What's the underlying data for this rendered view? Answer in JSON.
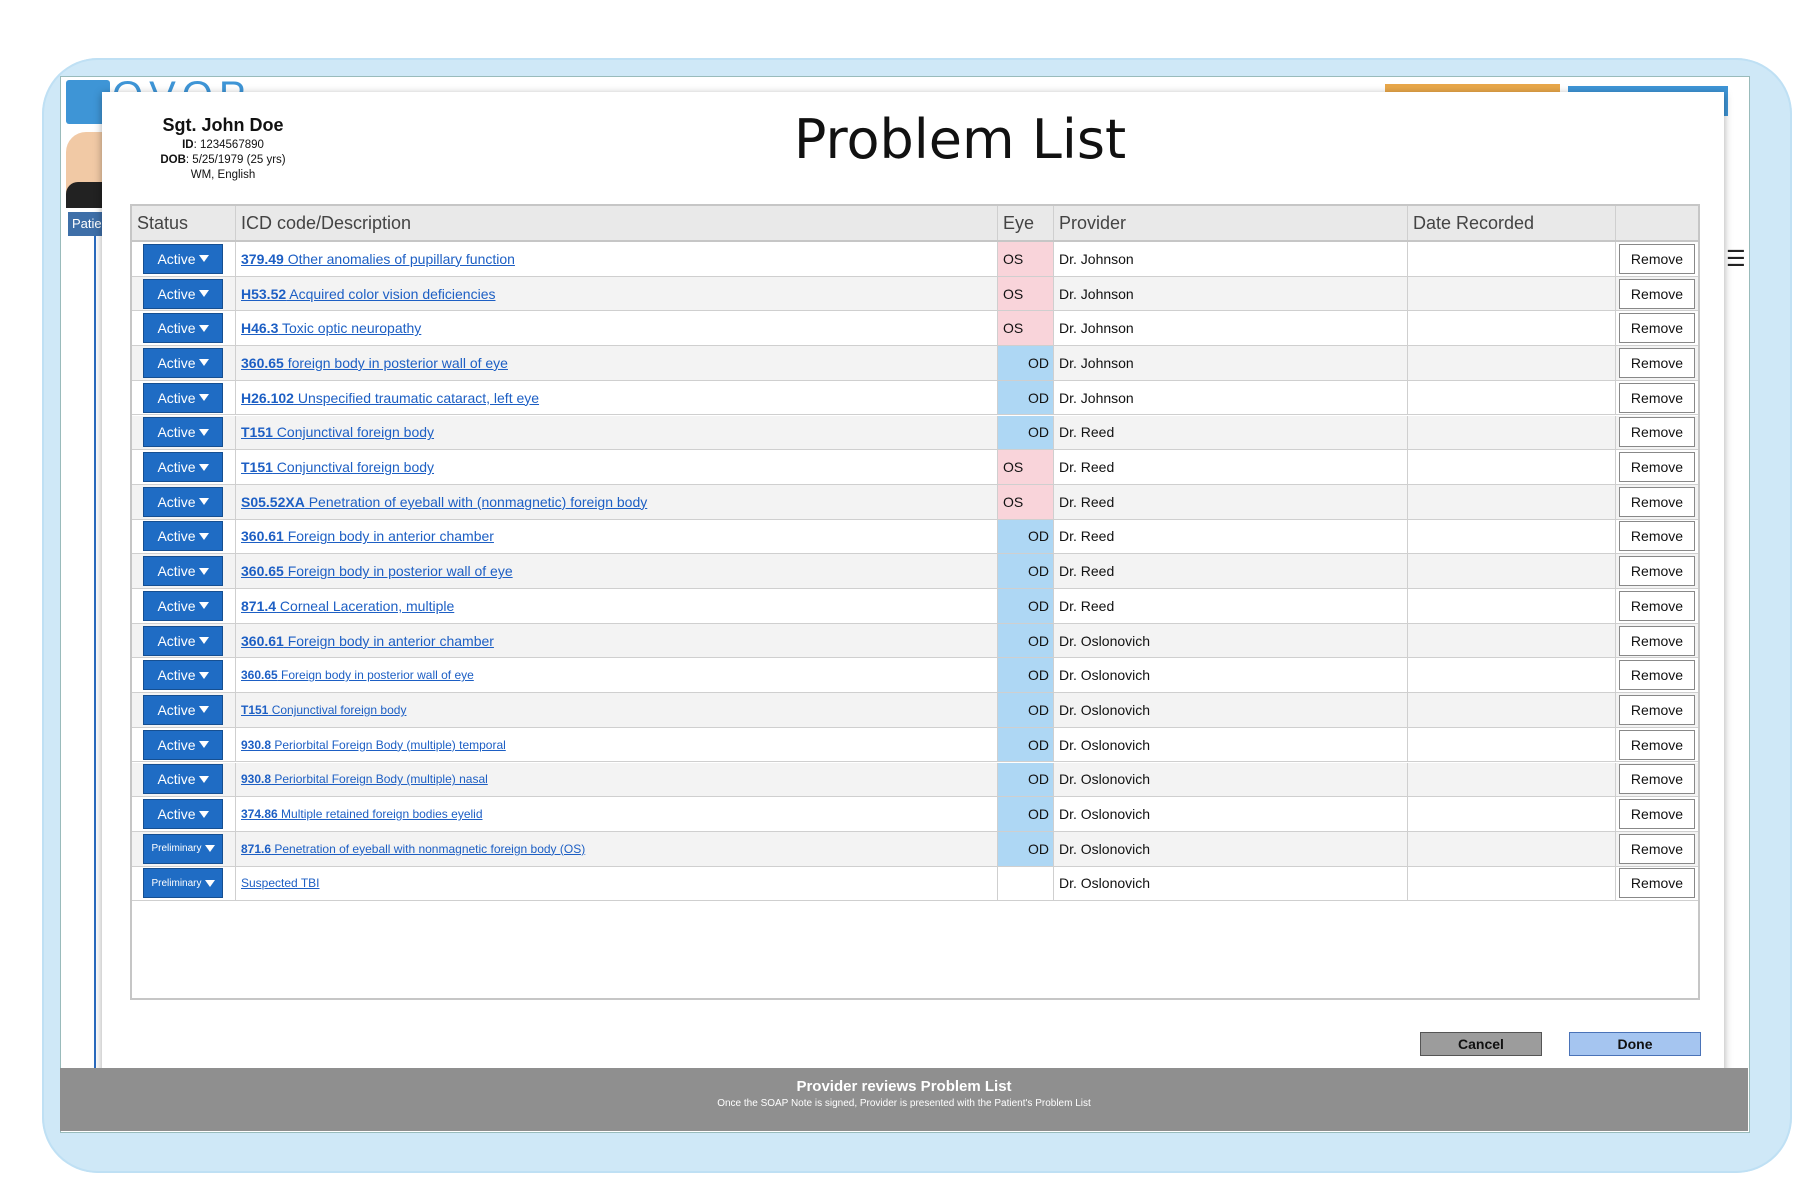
{
  "app": {
    "logo_text": "OVOP",
    "patient_tab": "Patie"
  },
  "patient": {
    "name": "Sgt. John Doe",
    "id_label": "ID",
    "id_value": ": 1234567890",
    "dob_label": "DOB",
    "dob_value": ": 5/25/1979 (25 yrs)",
    "demo": "WM, English"
  },
  "title": "Problem List",
  "columns": {
    "status": "Status",
    "desc": "ICD code/Description",
    "eye": "Eye",
    "provider": "Provider",
    "date": "Date Recorded",
    "action": ""
  },
  "rows": [
    {
      "status": "Active",
      "code": "379.49",
      "desc": " Other anomalies of pupillary function",
      "eye": "OS",
      "provider": "Dr. Johnson",
      "date": "",
      "action": "Remove"
    },
    {
      "status": "Active",
      "code": "H53.52",
      "desc": " Acquired color vision deficiencies",
      "eye": "OS",
      "provider": "Dr. Johnson",
      "date": "",
      "action": "Remove"
    },
    {
      "status": "Active",
      "code": "H46.3",
      "desc": " Toxic optic neuropathy",
      "eye": "OS",
      "provider": "Dr. Johnson",
      "date": "",
      "action": "Remove"
    },
    {
      "status": "Active",
      "code": "360.65",
      "desc": " foreign body in posterior wall of eye",
      "eye": "OD",
      "provider": "Dr. Johnson",
      "date": "",
      "action": "Remove"
    },
    {
      "status": "Active",
      "code": "H26.102",
      "desc": " Unspecified traumatic cataract, left eye",
      "eye": "OD",
      "provider": "Dr. Johnson",
      "date": "",
      "action": "Remove"
    },
    {
      "status": "Active",
      "code": "T151",
      "desc": " Conjunctival foreign body",
      "eye": "OD",
      "provider": "Dr. Reed",
      "date": "",
      "action": "Remove"
    },
    {
      "status": "Active",
      "code": "T151",
      "desc": " Conjunctival foreign body",
      "eye": "OS",
      "provider": "Dr. Reed",
      "date": "",
      "action": "Remove"
    },
    {
      "status": "Active",
      "code": "S05.52XA",
      "desc": " Penetration of eyeball with (nonmagnetic) foreign body",
      "eye": "OS",
      "provider": "Dr. Reed",
      "date": "",
      "action": "Remove"
    },
    {
      "status": "Active",
      "code": "360.61",
      "desc": " Foreign body in anterior chamber",
      "eye": "OD",
      "provider": "Dr. Reed",
      "date": "",
      "action": "Remove"
    },
    {
      "status": "Active",
      "code": "360.65",
      "desc": " Foreign body in posterior wall of eye",
      "eye": "OD",
      "provider": "Dr. Reed",
      "date": "",
      "action": "Remove"
    },
    {
      "status": "Active",
      "code": "871.4",
      "desc": " Corneal Laceration, multiple",
      "eye": "OD",
      "provider": "Dr. Reed",
      "date": "",
      "action": "Remove"
    },
    {
      "status": "Active",
      "code": "360.61",
      "desc": " Foreign body in anterior chamber",
      "eye": "OD",
      "provider": "Dr. Oslonovich",
      "date": "",
      "action": "Remove"
    },
    {
      "status": "Active",
      "code": "360.65",
      "desc": " Foreign body in posterior wall of eye",
      "eye": "OD",
      "provider": "Dr. Oslonovich",
      "date": "",
      "action": "Remove",
      "small": true
    },
    {
      "status": "Active",
      "code": "T151",
      "desc": " Conjunctival foreign body",
      "eye": "OD",
      "provider": "Dr. Oslonovich",
      "date": "",
      "action": "Remove",
      "small": true
    },
    {
      "status": "Active",
      "code": "930.8",
      "desc": " Periorbital Foreign Body (multiple) temporal",
      "eye": "OD",
      "provider": "Dr. Oslonovich",
      "date": "",
      "action": "Remove",
      "small": true
    },
    {
      "status": "Active",
      "code": "930.8",
      "desc": " Periorbital Foreign Body (multiple) nasal",
      "eye": "OD",
      "provider": "Dr. Oslonovich",
      "date": "",
      "action": "Remove",
      "small": true
    },
    {
      "status": "Active",
      "code": "374.86",
      "desc": " Multiple retained foreign bodies eyelid",
      "eye": "OD",
      "provider": "Dr. Oslonovich",
      "date": "",
      "action": "Remove",
      "small": true
    },
    {
      "status": "Preliminary",
      "code": "871.6",
      "desc": " Penetration of eyeball with nonmagnetic foreign body (OS)",
      "eye": "OD",
      "provider": "Dr. Oslonovich",
      "date": "",
      "action": "Remove",
      "small": true
    },
    {
      "status": "Preliminary",
      "code": "",
      "desc": "Suspected TBI",
      "eye": "",
      "provider": "Dr. Oslonovich",
      "date": "",
      "action": "Remove",
      "small": true
    }
  ],
  "buttons": {
    "cancel": "Cancel",
    "done": "Done"
  },
  "caption": {
    "title": "Provider reviews Problem List",
    "subtitle": "Once the SOAP Note is signed, Provider is presented with the Patient's Problem List"
  },
  "colors": {
    "status_button": "#1f6cc4",
    "eye_os": "#f9d4da",
    "eye_od": "#aed7f4",
    "link": "#1d5fc4",
    "done_button": "#a5c5f0",
    "cancel_button": "#9c9c9c",
    "caption_bar": "#8f8f8f"
  }
}
